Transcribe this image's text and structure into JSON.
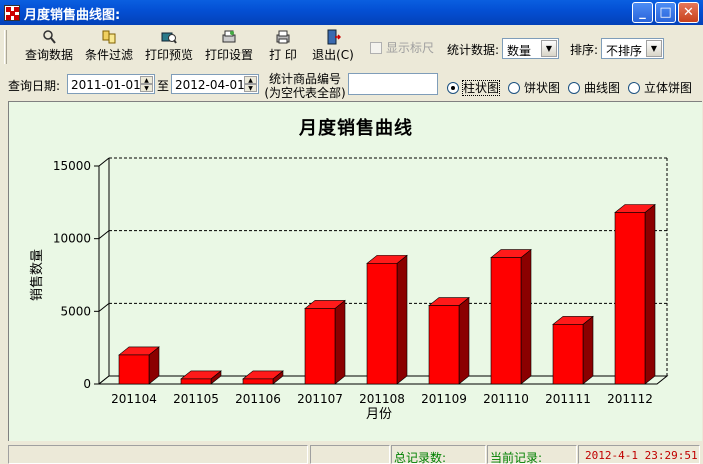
{
  "window": {
    "title": "月度销售曲线图:"
  },
  "toolbar": {
    "query_label": "查询数据",
    "filter_label": "条件过滤",
    "preview_label": "打印预览",
    "print_setup_label": "打印设置",
    "print_label": "打 印",
    "exit_label": "退出(C)",
    "show_ruler_label": "显示标尺",
    "stat_label": "统计数据:",
    "stat_value": "数量",
    "sort_label": "排序:",
    "sort_value": "不排序"
  },
  "filter": {
    "date_label": "查询日期:",
    "start_date": "2011-01-01",
    "to_label": "至",
    "end_date": "2012-04-01",
    "product_label_line1": "统计商品编号",
    "product_label_line2": "(为空代表全部)",
    "product_value": ""
  },
  "chart_types": {
    "bar": "柱状图",
    "pie": "饼状图",
    "line": "曲线图",
    "pie3d": "立体饼图",
    "selected": "bar"
  },
  "chart_data": {
    "type": "bar",
    "title": "月度销售曲线",
    "xlabel": "月份",
    "ylabel": "销售数量",
    "categories": [
      "201104",
      "201105",
      "201106",
      "201107",
      "201108",
      "201109",
      "201110",
      "201111",
      "201112"
    ],
    "values": [
      2000,
      350,
      350,
      5200,
      8300,
      5400,
      8700,
      4100,
      11800
    ],
    "ylim": [
      0,
      15000
    ],
    "yticks": [
      0,
      5000,
      10000,
      15000
    ],
    "bar_color": "#ff0000",
    "grid": true
  },
  "status": {
    "total_label": "总记录数:",
    "current_label": "当前记录:",
    "datetime": "2012-4-1  23:29:51"
  }
}
